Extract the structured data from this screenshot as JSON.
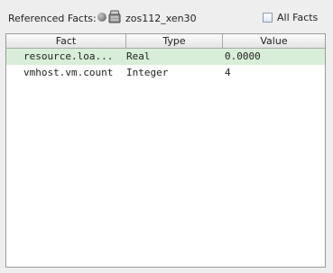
{
  "header": {
    "referenced_label": "Referenced Facts:",
    "host_name": "zos112_xen30",
    "status_icon": "gray-status-dot-icon",
    "host_icon": "server-host-icon",
    "all_facts_label": "All Facts",
    "all_facts_checked": false
  },
  "table": {
    "columns": [
      "Fact",
      "Type",
      "Value"
    ],
    "rows": [
      {
        "fact": "resource.loa...",
        "type": "Real",
        "value": "0.0000",
        "selected": true
      },
      {
        "fact": "vmhost.vm.count",
        "type": "Integer",
        "value": "4",
        "selected": false
      }
    ]
  },
  "colors": {
    "selected_row": "#d9eed9",
    "background": "#eeeeee"
  }
}
